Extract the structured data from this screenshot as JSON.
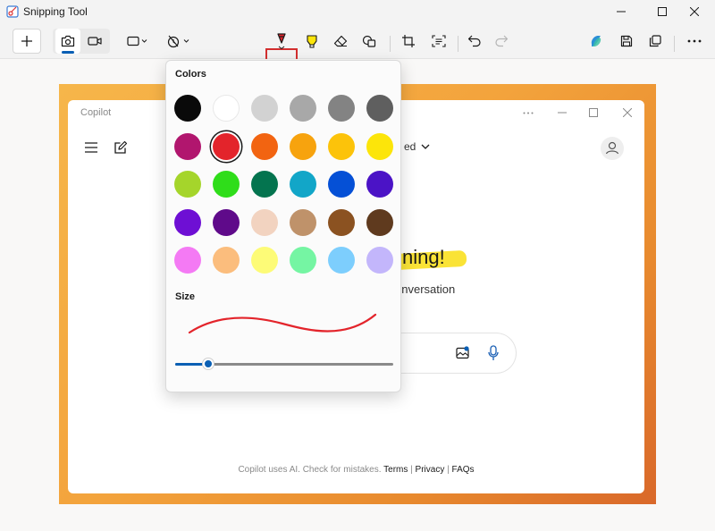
{
  "window": {
    "title": "Snipping Tool"
  },
  "toolbar": {
    "tools": [
      "new-snip",
      "photo-mode",
      "video-mode",
      "snip-shape",
      "delay",
      "ballpoint-pen",
      "highlighter",
      "eraser",
      "shapes",
      "crop",
      "text-actions",
      "undo",
      "redo",
      "copilot",
      "save",
      "copy",
      "more"
    ]
  },
  "popup": {
    "colors_label": "Colors",
    "size_label": "Size",
    "colors": [
      "#0a0a0a",
      "#ffffff",
      "#d2d2d2",
      "#a8a8a8",
      "#838383",
      "#5f5f5f",
      "#b1166e",
      "#e3242b",
      "#f26411",
      "#f7a30e",
      "#fcc30a",
      "#fce50a",
      "#a5d52b",
      "#2fdd1a",
      "#04744f",
      "#12a6c8",
      "#0550d6",
      "#4b13c6",
      "#6e0fd4",
      "#5f0a8a",
      "#f2d3c0",
      "#bf926a",
      "#8b5221",
      "#5f3a1e",
      "#f47af4",
      "#fbbd7d",
      "#fdfb77",
      "#75f5a3",
      "#7dcefd",
      "#c3b6fb"
    ],
    "selected_index": 7,
    "selected_color": "#e3242b",
    "size_fraction": 0.15
  },
  "copilot": {
    "window_title": "Copilot",
    "partial_header": "ed",
    "greeting": "ning!",
    "subtitle": "onversation",
    "footer_text": "Copilot uses AI. Check for mistakes.",
    "footer_terms": "Terms",
    "footer_sep": "|",
    "footer_privacy": "Privacy",
    "footer_faqs": "FAQs"
  }
}
